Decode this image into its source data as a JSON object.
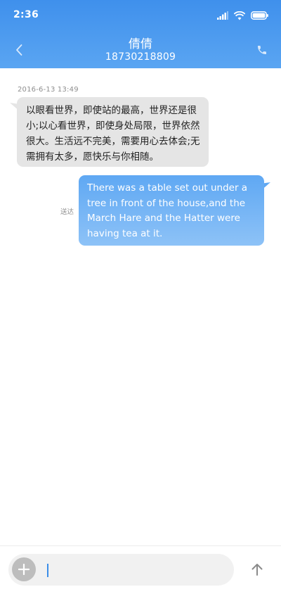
{
  "status_bar": {
    "time": "2:36",
    "icons": [
      "signal-icon",
      "wifi-icon",
      "battery-icon"
    ]
  },
  "nav": {
    "back_icon": "chevron-left-icon",
    "contact_name": "倩倩",
    "contact_number": "18730218809",
    "call_icon": "phone-icon"
  },
  "conversation": {
    "timestamp": "2016-6-13 13:49",
    "messages": [
      {
        "direction": "incoming",
        "text": "以眼看世界，即使站的最高，世界还是很小;以心看世界，即使身处局限，世界依然很大。生活远不完美，需要用心去体会;无需拥有太多，愿快乐与你相随。"
      },
      {
        "direction": "outgoing",
        "text": "There was a table set out under a tree in front of the house,and the March Hare and the Hatter were having tea at it.",
        "status": "送达"
      }
    ]
  },
  "composer": {
    "add_icon": "plus-icon",
    "input_value": "",
    "send_icon": "arrow-up-icon"
  },
  "colors": {
    "header_top": "#3f90ec",
    "header_bottom": "#5aa5f2",
    "incoming_bubble": "#e5e5e5",
    "outgoing_bubble_top": "#5fa8f3",
    "outgoing_bubble_bottom": "#8dc2f7",
    "caret": "#3b8ee8"
  }
}
